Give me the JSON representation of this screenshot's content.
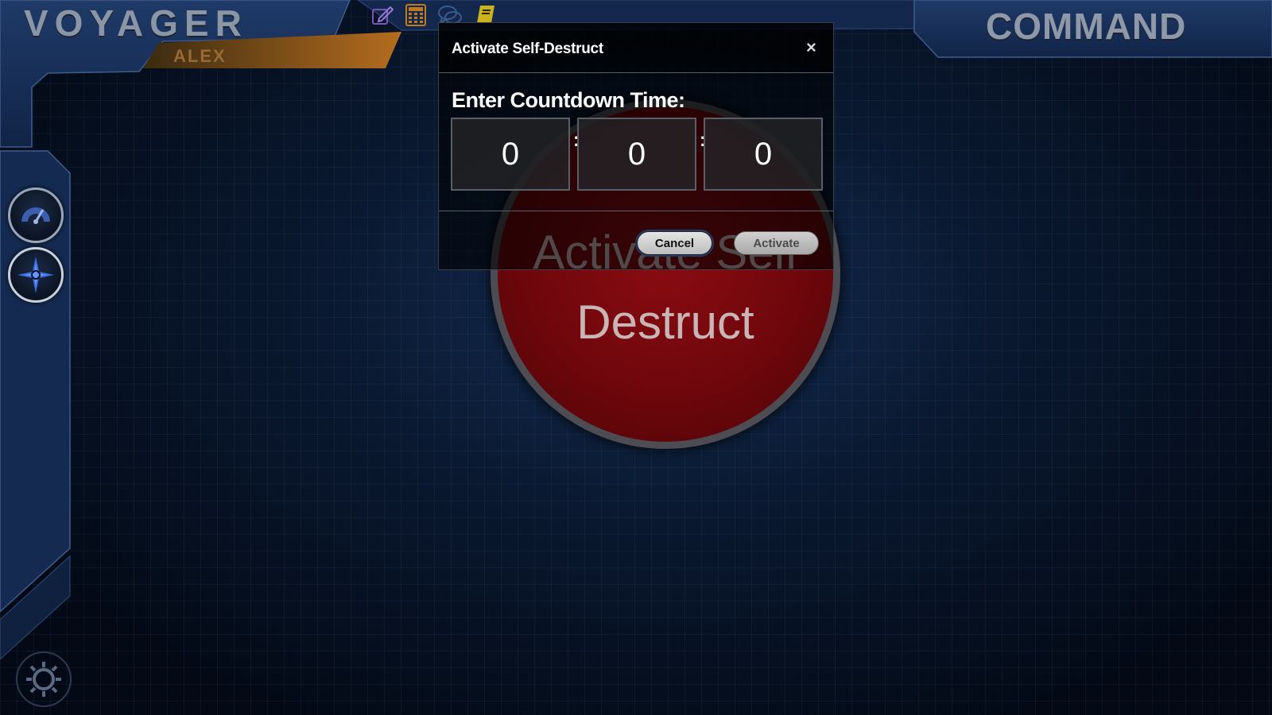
{
  "header": {
    "app_title": "VOYAGER",
    "user_name": "ALEX",
    "station_title": "COMMAND"
  },
  "toolbar": {
    "items": [
      {
        "icon": "edit-icon",
        "color": "#7a56b8"
      },
      {
        "icon": "calculator-icon",
        "color": "#c07a1e"
      },
      {
        "icon": "chat-icon",
        "color": "#3a5a8c"
      },
      {
        "icon": "notebook-icon",
        "color": "#c9b21e"
      }
    ]
  },
  "sidebar": {
    "items": [
      {
        "icon": "speedometer-icon"
      },
      {
        "icon": "compass-star-icon",
        "active_color": "#3b6fe6"
      }
    ],
    "settings_icon": "gear-icon"
  },
  "main": {
    "self_destruct_label": "Activate Self\nDestruct",
    "button_color": "#7a0a10"
  },
  "modal": {
    "title": "Activate Self-Destruct",
    "close_label": "×",
    "prompt": "Enter Countdown Time:",
    "hours": "0",
    "minutes": "0",
    "seconds": "0",
    "separator": ":",
    "cancel_label": "Cancel",
    "activate_label": "Activate"
  }
}
